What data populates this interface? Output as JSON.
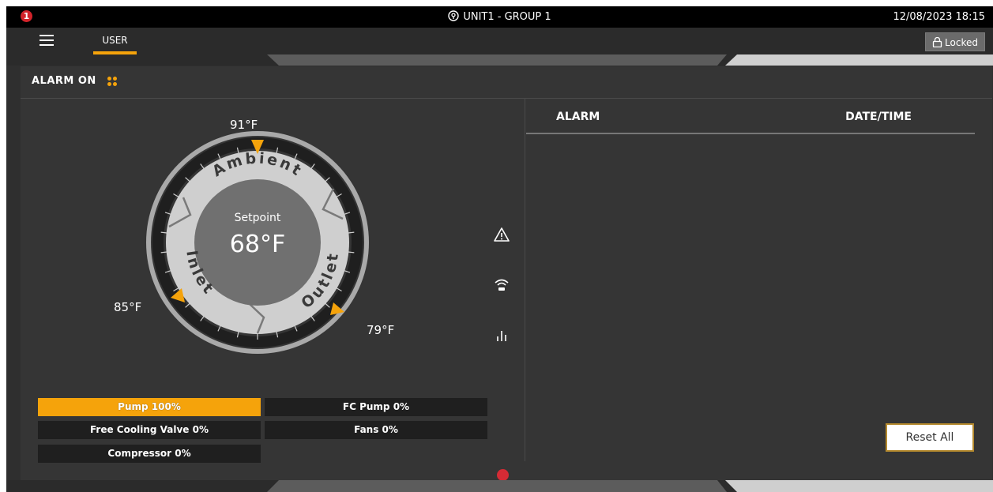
{
  "topbar": {
    "alert_count": "1",
    "unit_title": "UNIT1 - GROUP 1",
    "datetime": "12/08/2023 18:15",
    "icons": [
      "map-pin-icon"
    ]
  },
  "navbar": {
    "tab_user": "USER",
    "locked_label": "Locked",
    "icons": [
      "menu-icon",
      "lock-icon"
    ]
  },
  "panel": {
    "alarm_on_label": "ALARM ON"
  },
  "dial": {
    "ambient_label": "Ambient",
    "inlet_label": "Inlet",
    "outlet_label": "Outlet",
    "setpoint_label": "Setpoint",
    "setpoint_value": "68°F",
    "ambient_temp": "91°F",
    "inlet_temp": "85°F",
    "outlet_temp": "79°F"
  },
  "status": {
    "pump": "Pump 100%",
    "fc_pump": "FC Pump 0%",
    "free_cooling_valve": "Free Cooling Valve 0%",
    "fans": "Fans 0%",
    "compressor": "Compressor 0%"
  },
  "side_icons": [
    "warning-icon",
    "wifi-icon",
    "bar-chart-icon"
  ],
  "alarm_table": {
    "col_alarm": "ALARM",
    "col_datetime": "DATE/TIME",
    "rows": []
  },
  "actions": {
    "reset_all": "Reset All"
  },
  "colors": {
    "accent": "#f5a30b",
    "background": "#2f2f2f",
    "alert": "#d2232a"
  }
}
